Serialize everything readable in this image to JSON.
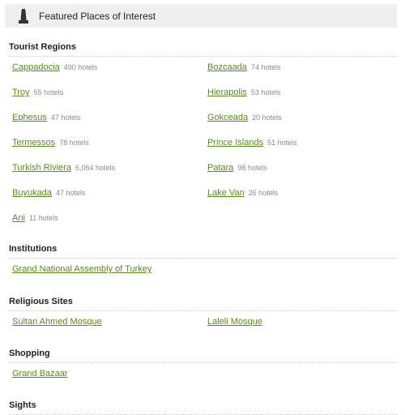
{
  "panel": {
    "title": "Featured Places of Interest",
    "icon": "monument-icon"
  },
  "sections": [
    {
      "heading": "Tourist Regions",
      "items": [
        {
          "name": "Cappadocia",
          "count": "490 hotels"
        },
        {
          "name": "Bozcaada",
          "count": "74 hotels"
        },
        {
          "name": "Troy",
          "count": "55 hotels"
        },
        {
          "name": "Hierapolis",
          "count": "53 hotels"
        },
        {
          "name": "Ephesus",
          "count": "47 hotels"
        },
        {
          "name": "Gokceada",
          "count": "20 hotels"
        },
        {
          "name": "Termessos",
          "count": "78 hotels"
        },
        {
          "name": "Prince Islands",
          "count": "51 hotels"
        },
        {
          "name": "Turkish Riviera",
          "count": "6,064 hotels"
        },
        {
          "name": "Patara",
          "count": "98 hotels"
        },
        {
          "name": "Buyukada",
          "count": "47 hotels"
        },
        {
          "name": "Lake Van",
          "count": "26 hotels"
        },
        {
          "name": "Ani",
          "count": "11 hotels"
        }
      ]
    },
    {
      "heading": "Institutions",
      "items": [
        {
          "name": "Grand National Assembly of Turkey"
        }
      ]
    },
    {
      "heading": "Religious Sites",
      "items": [
        {
          "name": "Sultan Ahmed Mosque"
        },
        {
          "name": "Laleli Mosque"
        }
      ]
    },
    {
      "heading": "Shopping",
      "items": [
        {
          "name": "Grand Bazaar"
        }
      ]
    },
    {
      "heading": "Sights",
      "items": []
    }
  ],
  "colors": {
    "link": "#5a8a1e",
    "count": "#8a8a8a",
    "header_bg": "#efefef"
  }
}
